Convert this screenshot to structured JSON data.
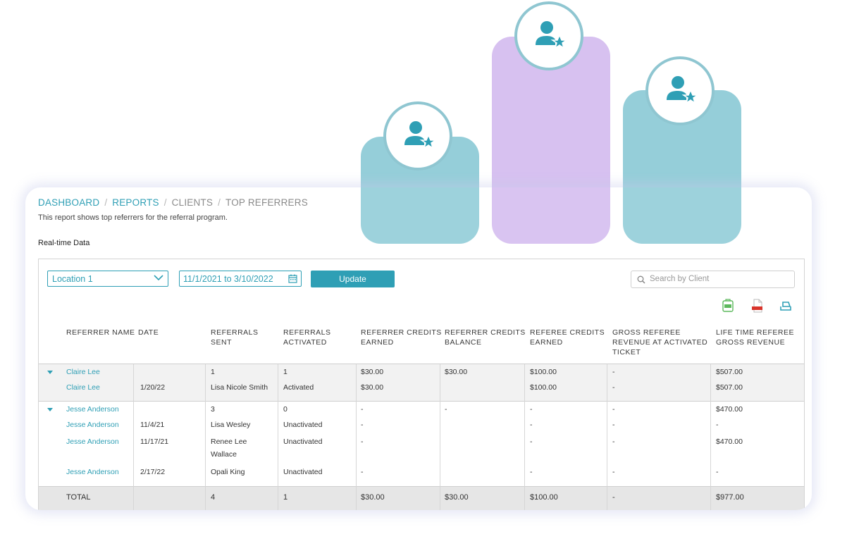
{
  "colors": {
    "accent": "#2f9fb5",
    "podium_teal": "#95ced9",
    "podium_purple": "#d7c1f0"
  },
  "breadcrumb": [
    "DASHBOARD",
    "REPORTS",
    "CLIENTS",
    "TOP REFERRERS"
  ],
  "description": "This report shows top referrers for the referral program.",
  "realtime_label": "Real-time Data",
  "filters": {
    "location": "Location 1",
    "date_range": "11/1/2021 to 3/10/2022",
    "update_label": "Update",
    "search_placeholder": "Search by Client"
  },
  "export_icons": [
    "csv-export-icon",
    "pdf-export-icon",
    "print-icon"
  ],
  "columns": [
    "REFERRER NAME",
    "DATE",
    "REFERRALS SENT",
    "REFERRALS ACTIVATED",
    "REFERRER CREDITS EARNED",
    "REFERRER CREDITS BALANCE",
    "REFEREE CREDITS EARNED",
    "GROSS REFEREE REVENUE AT ACTIVATED TICKET",
    "LIFE TIME REFEREE GROSS REVENUE"
  ],
  "groups": [
    {
      "summary": [
        "Claire Lee",
        "",
        "1",
        "1",
        "$30.00",
        "$30.00",
        "$100.00",
        "-",
        "$507.00"
      ],
      "details": [
        [
          "Claire Lee",
          "1/20/22",
          "Lisa Nicole Smith",
          "Activated",
          "$30.00",
          "",
          "$100.00",
          "-",
          "$507.00"
        ]
      ]
    },
    {
      "summary": [
        "Jesse Anderson",
        "",
        "3",
        "0",
        "-",
        "-",
        "-",
        "-",
        "$470.00"
      ],
      "details": [
        [
          "Jesse Anderson",
          "11/4/21",
          "Lisa Wesley",
          "Unactivated",
          "-",
          "",
          "-",
          "-",
          "-"
        ],
        [
          "Jesse Anderson",
          "11/17/21",
          "Renee Lee Wallace",
          "Unactivated",
          "-",
          "",
          "-",
          "-",
          "$470.00"
        ],
        [
          "Jesse Anderson",
          "2/17/22",
          "Opali King",
          "Unactivated",
          "-",
          "",
          "-",
          "-",
          "-"
        ]
      ]
    }
  ],
  "total": [
    "TOTAL",
    "",
    "4",
    "1",
    "$30.00",
    "$30.00",
    "$100.00",
    "-",
    "$977.00"
  ]
}
